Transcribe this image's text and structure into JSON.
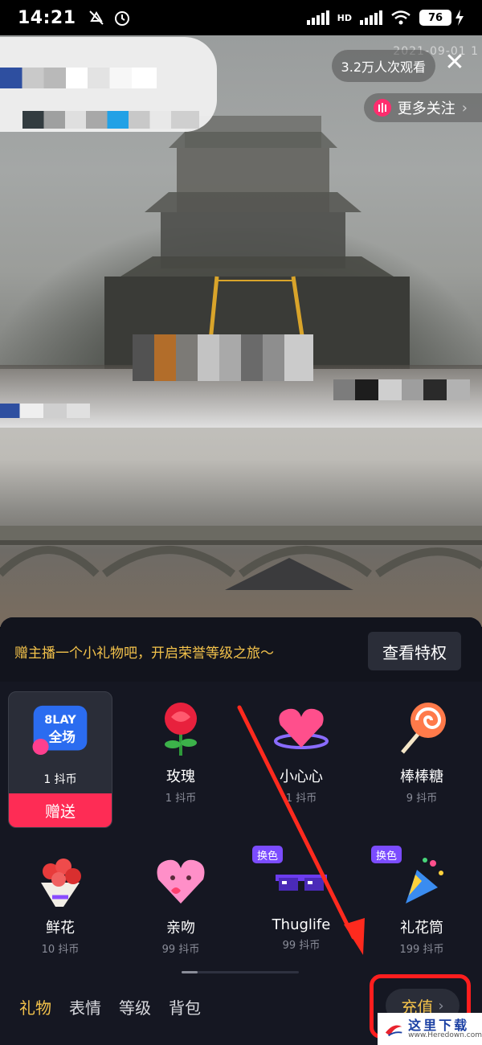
{
  "status_bar": {
    "time": "14:21",
    "battery": "76",
    "network": "HD",
    "icons": [
      "mute-icon",
      "alarm-icon",
      "signal-icon",
      "wifi-icon",
      "charging-icon"
    ]
  },
  "video": {
    "viewers": "3.2万人次观看",
    "date_stamp": "2021-09-01 1",
    "follow_label": "更多关注",
    "close_symbol": "✕"
  },
  "gift_panel": {
    "promo_text": "赠主播一个小礼物吧，开启荣誉等级之旅～",
    "privilege_button": "查看特权",
    "selected_gift": {
      "price": "1 抖币",
      "send_label": "赠送",
      "badge_text": "8LAY 全场"
    },
    "gifts": [
      {
        "name": "玫瑰",
        "price": "1 抖币",
        "icon": "rose-icon"
      },
      {
        "name": "小心心",
        "price": "1 抖币",
        "icon": "heart-icon"
      },
      {
        "name": "棒棒糖",
        "price": "9 抖币",
        "icon": "lollipop-icon"
      },
      {
        "name": "鲜花",
        "price": "10 抖币",
        "icon": "bouquet-icon"
      },
      {
        "name": "亲吻",
        "price": "99 抖币",
        "icon": "kiss-icon"
      },
      {
        "name": "Thuglife",
        "price": "99 抖币",
        "icon": "sunglasses-icon",
        "badge": "换色"
      },
      {
        "name": "礼花筒",
        "price": "199 抖币",
        "icon": "party-popper-icon",
        "badge": "换色"
      }
    ],
    "tabs": [
      {
        "label": "礼物",
        "active": true
      },
      {
        "label": "表情",
        "active": false
      },
      {
        "label": "等级",
        "active": false
      },
      {
        "label": "背包",
        "active": false
      }
    ],
    "recharge_label": "充值",
    "recharge_chevron": "›"
  },
  "watermark": {
    "cn": "这里下载",
    "en": "www.Heredown.com"
  },
  "colors": {
    "accent": "#f3c24b",
    "send": "#fe2c55",
    "badge": "#7b4cff",
    "annotation": "#ff1e1e"
  }
}
